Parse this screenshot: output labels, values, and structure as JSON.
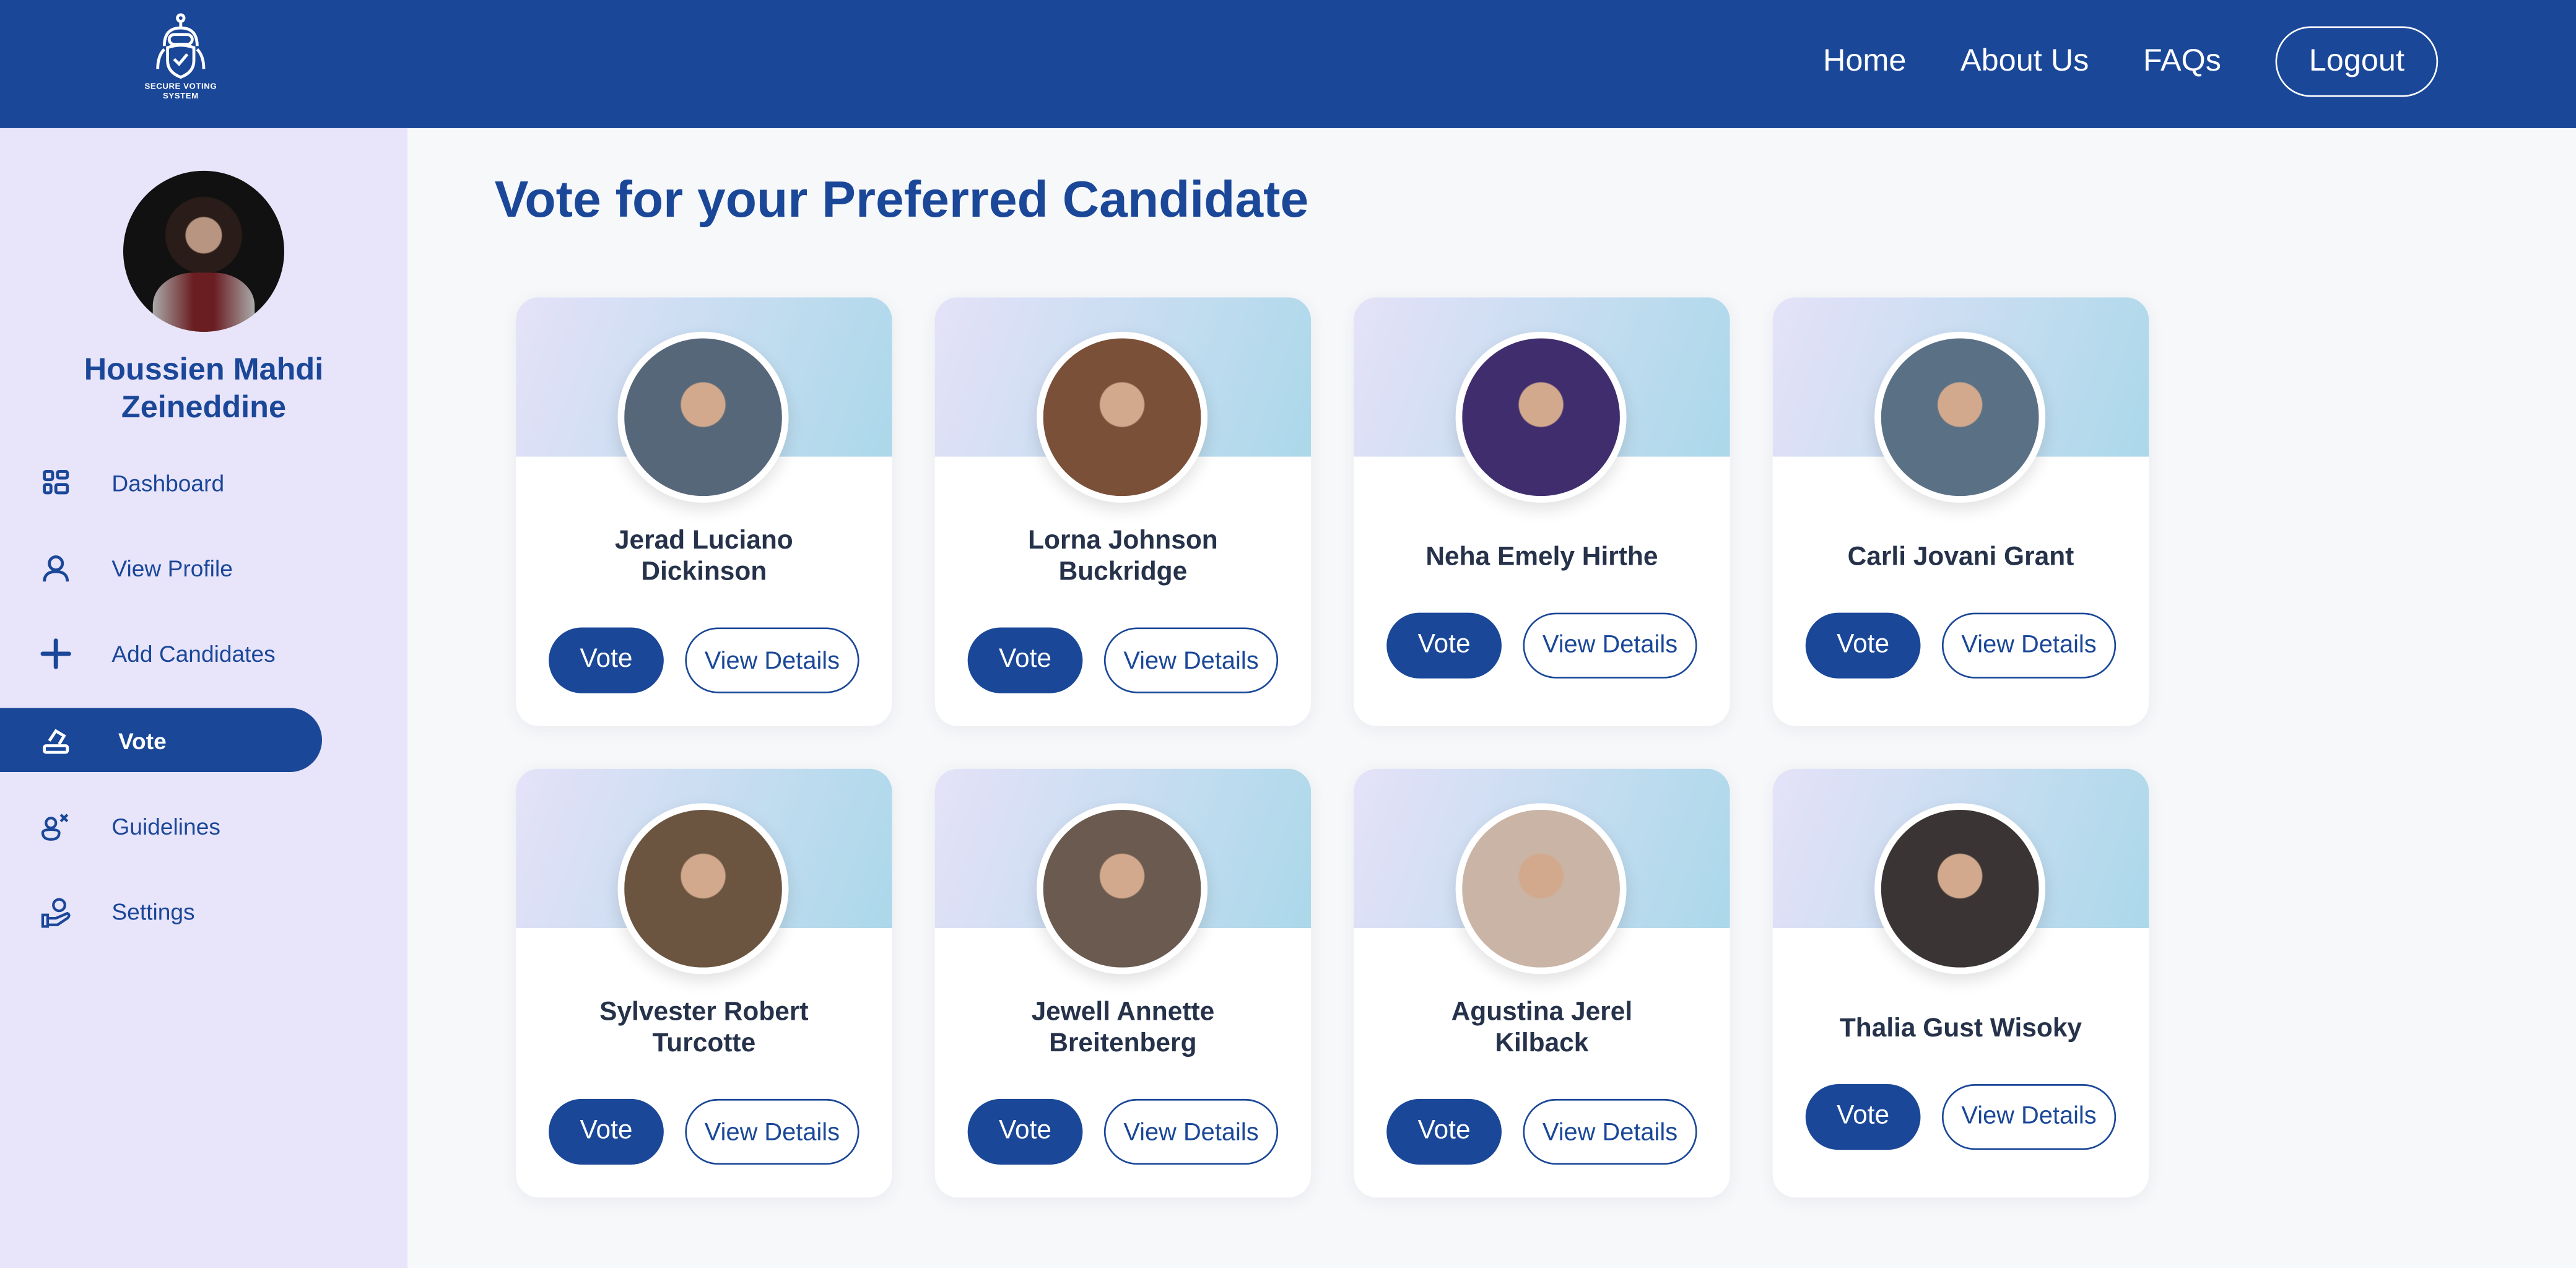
{
  "header": {
    "logo_text": "SECURE VOTING SYSTEM",
    "nav": [
      "Home",
      "About Us",
      "FAQs"
    ],
    "logout": "Logout"
  },
  "sidebar": {
    "user_name": "Houssien Mahdi Zeineddine",
    "items": [
      {
        "label": "Dashboard",
        "icon": "grid-icon"
      },
      {
        "label": "View Profile",
        "icon": "user-icon"
      },
      {
        "label": "Add Candidates",
        "icon": "plus-icon"
      },
      {
        "label": "Vote",
        "icon": "ballot-icon",
        "active": true
      },
      {
        "label": "Guidelines",
        "icon": "user-x-icon"
      },
      {
        "label": "Settings",
        "icon": "hand-gear-icon"
      }
    ]
  },
  "main": {
    "title": "Vote for your Preferred Candidate",
    "vote_label": "Vote",
    "details_label": "View Details",
    "candidates": [
      {
        "name": "Jerad Luciano Dickinson",
        "photo": "#56677a"
      },
      {
        "name": "Lorna Johnson Buckridge",
        "photo": "#7a5038"
      },
      {
        "name": "Neha Emely Hirthe",
        "photo": "#3f2d6e"
      },
      {
        "name": "Carli Jovani Grant",
        "photo": "#5a7085"
      },
      {
        "name": "Sylvester Robert Turcotte",
        "photo": "#6b5540"
      },
      {
        "name": "Jewell Annette Breitenberg",
        "photo": "#6a5a50"
      },
      {
        "name": "Agustina Jerel Kilback",
        "photo": "#c9b4a6"
      },
      {
        "name": "Thalia Gust Wisoky",
        "photo": "#3a3534"
      }
    ]
  }
}
